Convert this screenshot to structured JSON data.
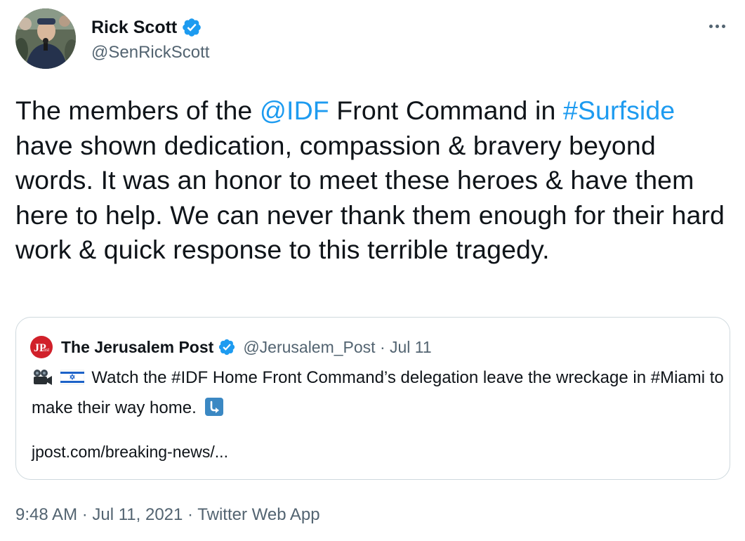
{
  "author": {
    "name": "Rick Scott",
    "handle": "@SenRickScott"
  },
  "tweet": {
    "text_1": "The members of the ",
    "mention": "@IDF",
    "text_2": " Front Command in ",
    "hashtag": "#Surfside",
    "text_3": " have shown dedication, compassion & bravery beyond words. It was an honor to meet these heroes & have them here to help. We can never thank them enough for their hard work & quick response to this terrible tragedy."
  },
  "quoted_tweet": {
    "name": "The Jerusalem Post",
    "meta": "@Jerusalem_Post · Jul 11",
    "logo_text": "JPost",
    "text_line": "Watch the #IDF Home Front Command’s delegation leave the wreckage in #Miami to make their way home.",
    "link": "jpost.com/breaking-news/..."
  },
  "footer": {
    "time": "9:48 AM",
    "sep1": " · ",
    "date": "Jul 11, 2021",
    "sep2": " · ",
    "source": "Twitter Web App"
  },
  "colors": {
    "link": "#1d9bf0",
    "secondary_text": "#536471",
    "border": "#cfd9de",
    "jpost_red": "#d1202a"
  },
  "icons": {
    "verified": "verified-badge-icon",
    "more": "more-dots-icon",
    "camera": "movie-camera-emoji-icon",
    "flag": "israel-flag-emoji-icon",
    "arrow": "arrow-down-right-emoji-icon"
  }
}
